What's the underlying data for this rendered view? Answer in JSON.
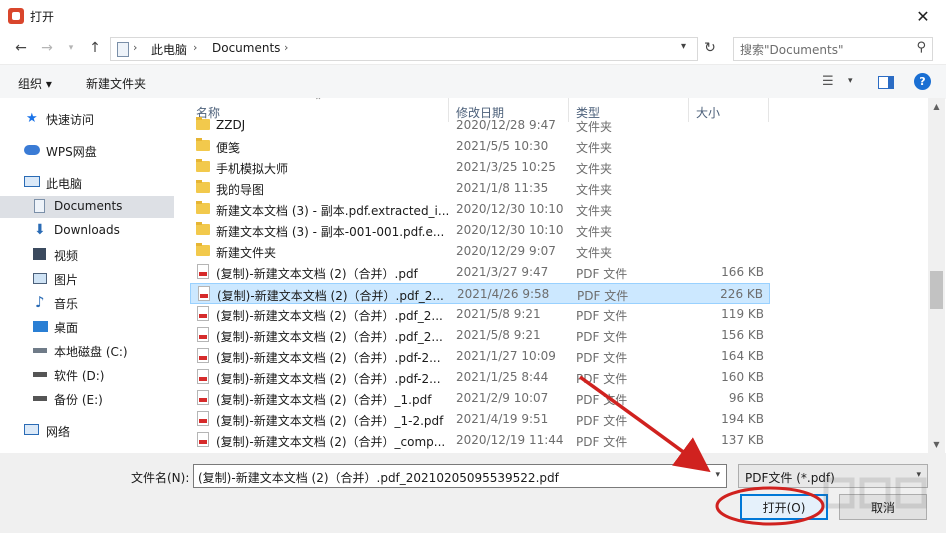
{
  "window": {
    "title": "打开",
    "close_icon": "close-icon"
  },
  "address": {
    "back_icon": "arrow-left-icon",
    "forward_icon": "arrow-right-icon",
    "recent_icon": "chevron-down-icon",
    "up_icon": "arrow-up-icon",
    "crumbs": [
      "此电脑",
      "Documents"
    ],
    "refresh_icon": "refresh-icon",
    "search_placeholder": "搜索\"Documents\""
  },
  "toolbar": {
    "organize_label": "组织 ▾",
    "new_folder_label": "新建文件夹",
    "help_label": "?"
  },
  "nav": {
    "items": [
      {
        "label": "快速访问",
        "icon": "star-icon"
      },
      {
        "label": "WPS网盘",
        "icon": "cloud-icon"
      },
      {
        "label": "此电脑",
        "icon": "computer-icon"
      },
      {
        "label": "Documents",
        "icon": "document-icon",
        "selected": true
      },
      {
        "label": "Downloads",
        "icon": "download-icon"
      },
      {
        "label": "视频",
        "icon": "video-icon"
      },
      {
        "label": "图片",
        "icon": "picture-icon"
      },
      {
        "label": "音乐",
        "icon": "music-icon"
      },
      {
        "label": "桌面",
        "icon": "desktop-icon"
      },
      {
        "label": "本地磁盘 (C:)",
        "icon": "drive-icon"
      },
      {
        "label": "软件 (D:)",
        "icon": "drive-icon"
      },
      {
        "label": "备份 (E:)",
        "icon": "drive-icon"
      },
      {
        "label": "网络",
        "icon": "network-icon"
      }
    ]
  },
  "columns": {
    "name": "名称",
    "date": "修改日期",
    "type": "类型",
    "size": "大小"
  },
  "files": [
    {
      "name": "ZZDJ",
      "date": "2020/12/28 9:47",
      "type": "文件夹",
      "size": "",
      "kind": "folder"
    },
    {
      "name": "便笺",
      "date": "2021/5/5 10:30",
      "type": "文件夹",
      "size": "",
      "kind": "folder"
    },
    {
      "name": "手机模拟大师",
      "date": "2021/3/25 10:25",
      "type": "文件夹",
      "size": "",
      "kind": "folder"
    },
    {
      "name": "我的导图",
      "date": "2021/1/8 11:35",
      "type": "文件夹",
      "size": "",
      "kind": "folder"
    },
    {
      "name": "新建文本文档 (3) - 副本.pdf.extracted_i...",
      "date": "2020/12/30 10:10",
      "type": "文件夹",
      "size": "",
      "kind": "folder"
    },
    {
      "name": "新建文本文档 (3) - 副本-001-001.pdf.e...",
      "date": "2020/12/30 10:10",
      "type": "文件夹",
      "size": "",
      "kind": "folder"
    },
    {
      "name": "新建文件夹",
      "date": "2020/12/29 9:07",
      "type": "文件夹",
      "size": "",
      "kind": "folder"
    },
    {
      "name": "(复制)-新建文本文档 (2)（合并）.pdf",
      "date": "2021/3/27 9:47",
      "type": "PDF 文件",
      "size": "166 KB",
      "kind": "pdf"
    },
    {
      "name": "(复制)-新建文本文档 (2)（合并）.pdf_2...",
      "date": "2021/4/26 9:58",
      "type": "PDF 文件",
      "size": "226 KB",
      "kind": "pdf",
      "selected": true
    },
    {
      "name": "(复制)-新建文本文档 (2)（合并）.pdf_2...",
      "date": "2021/5/8 9:21",
      "type": "PDF 文件",
      "size": "119 KB",
      "kind": "pdf"
    },
    {
      "name": "(复制)-新建文本文档 (2)（合并）.pdf_2...",
      "date": "2021/5/8 9:21",
      "type": "PDF 文件",
      "size": "156 KB",
      "kind": "pdf"
    },
    {
      "name": "(复制)-新建文本文档 (2)（合并）.pdf-2...",
      "date": "2021/1/27 10:09",
      "type": "PDF 文件",
      "size": "164 KB",
      "kind": "pdf"
    },
    {
      "name": "(复制)-新建文本文档 (2)（合并）.pdf-2...",
      "date": "2021/1/25 8:44",
      "type": "PDF 文件",
      "size": "160 KB",
      "kind": "pdf"
    },
    {
      "name": "(复制)-新建文本文档 (2)（合并）_1.pdf",
      "date": "2021/2/9 10:07",
      "type": "PDF 文件",
      "size": "96 KB",
      "kind": "pdf"
    },
    {
      "name": "(复制)-新建文本文档 (2)（合并）_1-2.pdf",
      "date": "2021/4/19 9:51",
      "type": "PDF 文件",
      "size": "194 KB",
      "kind": "pdf"
    },
    {
      "name": "(复制)-新建文本文档 (2)（合并）_comp...",
      "date": "2020/12/19 11:44",
      "type": "PDF 文件",
      "size": "137 KB",
      "kind": "pdf"
    }
  ],
  "scrollbar": {
    "up_icon": "scroll-up-icon",
    "down_icon": "scroll-down-icon",
    "position": 0.55
  },
  "bottom": {
    "filename_label": "文件名(N):",
    "filename_value": "(复制)-新建文本文档 (2)（合并）.pdf_20210205095539522.pdf",
    "filter_value": "PDF文件 (*.pdf)",
    "open_label": "打开(O)",
    "cancel_label": "取消"
  },
  "annotation": {
    "color": "#d0221f"
  }
}
